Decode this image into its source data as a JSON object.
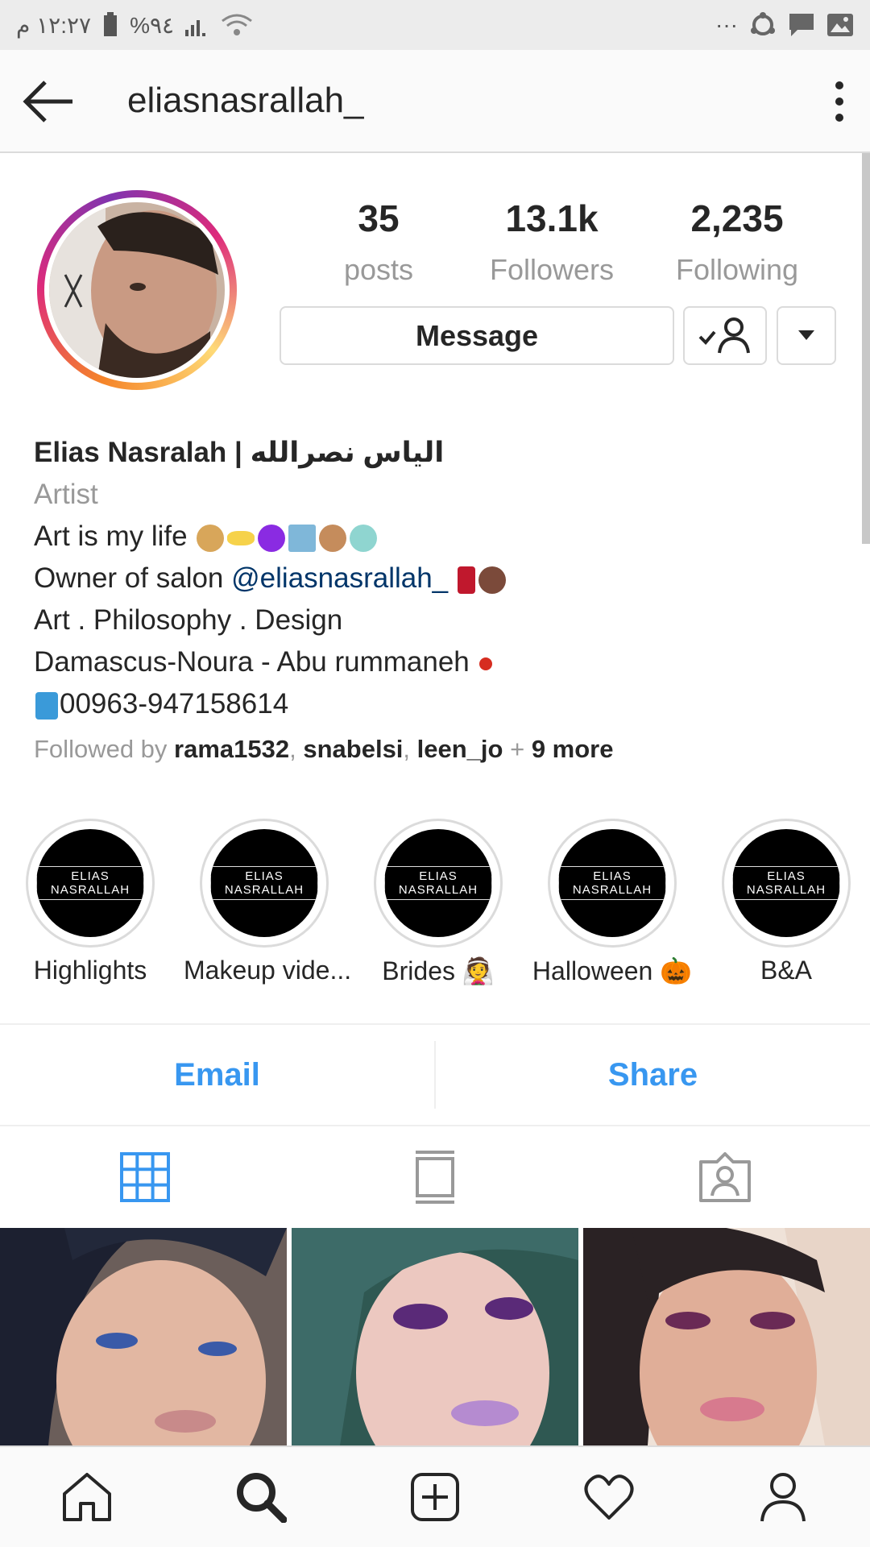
{
  "status_bar": {
    "time": "١٢:٢٧ م",
    "battery": "%٩٤",
    "dots": "···"
  },
  "header": {
    "username": "eliasnasrallah_"
  },
  "profile": {
    "stats": [
      {
        "value": "35",
        "label": "posts"
      },
      {
        "value": "13.1k",
        "label": "Followers"
      },
      {
        "value": "2,235",
        "label": "Following"
      }
    ],
    "message_label": "Message"
  },
  "bio": {
    "name": "Elias Nasralah | الياس نصرالله",
    "category": "Artist",
    "line1": "Art is my life",
    "line2_prefix": "Owner of salon",
    "line2_mention": "@eliasnasrallah_",
    "line3": "Art . Philosophy . Design",
    "line4": "Damascus-Noura - Abu rummaneh",
    "line5": "00963-947158614",
    "followed_prefix": "Followed by",
    "followed_users": [
      "rama1532",
      "snabelsi",
      "leen_jo"
    ],
    "followed_more": "9 more"
  },
  "highlights": [
    {
      "label": "Highlights",
      "logo": "ELIAS NASRALLAH"
    },
    {
      "label": "Makeup vide...",
      "logo": "ELIAS NASRALLAH"
    },
    {
      "label": "Brides 👰",
      "logo": "ELIAS NASRALLAH"
    },
    {
      "label": "Halloween 🎃",
      "logo": "ELIAS NASRALLAH"
    },
    {
      "label": "B&A",
      "logo": "ELIAS NASRALLAH"
    }
  ],
  "actions": {
    "email": "Email",
    "share": "Share"
  },
  "colors": {
    "link_blue": "#3897f0",
    "mention": "#003569",
    "muted": "#999999"
  }
}
